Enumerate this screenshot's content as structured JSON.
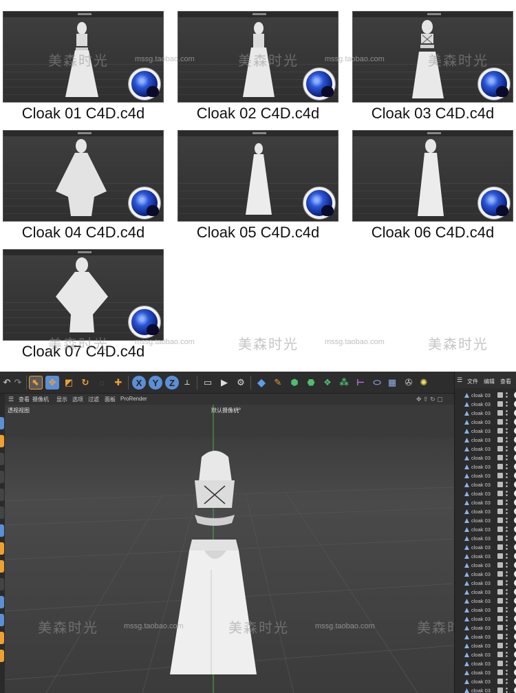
{
  "gallery": {
    "thumbnails": [
      {
        "caption": "Cloak 01 C4D.c4d"
      },
      {
        "caption": "Cloak 02 C4D.c4d"
      },
      {
        "caption": "Cloak 03 C4D.c4d"
      },
      {
        "caption": "Cloak 04 C4D.c4d"
      },
      {
        "caption": "Cloak 05 C4D.c4d"
      },
      {
        "caption": "Cloak 06 C4D.c4d"
      },
      {
        "caption": "Cloak 07 C4D.c4d"
      }
    ],
    "watermark_text": "美森时光",
    "watermark_url": "mssg.taobao.com"
  },
  "editor": {
    "toolbar": {
      "axis_x": "X",
      "axis_y": "Y",
      "axis_z": "Z"
    },
    "viewport_menu": [
      "查看",
      "摄像机",
      "显示",
      "选项",
      "过滤",
      "面板",
      "ProRender"
    ],
    "viewport_name": "透视视图",
    "camera_name": "默认摄像机",
    "camera_suffix": "•º",
    "right_panel": {
      "menu": [
        "文件",
        "编辑",
        "查看"
      ],
      "object_name": "cloak 03",
      "object_rows": 34
    },
    "colors": {
      "accent_orange": "#f0a030",
      "axis_blue": "#5b8fd6",
      "viewport_bg": "#3d3d3d"
    }
  }
}
